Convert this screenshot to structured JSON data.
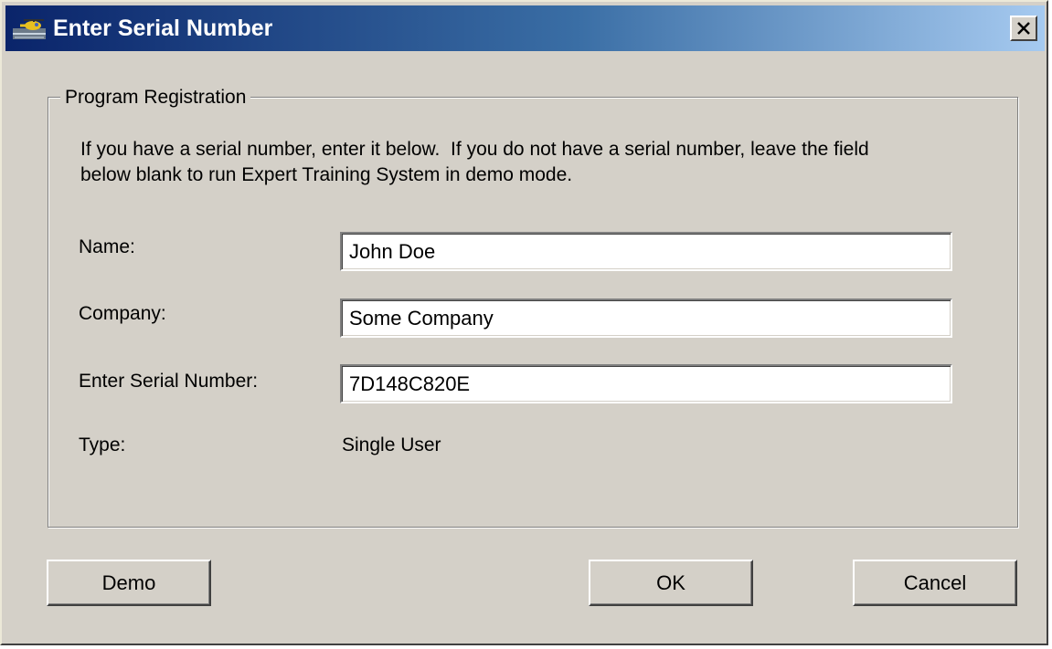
{
  "window": {
    "title": "Enter Serial Number",
    "app_icon": "helicopter-icon",
    "close_icon": "close-x-icon",
    "title_gradient": [
      "#0a246a",
      "#a6caf0"
    ],
    "face_color": "#d4d0c8"
  },
  "group": {
    "label": "Program Registration",
    "instructions_line1": "If you have a serial number, enter it below.  If you do not have a serial number, leave the field",
    "instructions_line2": "below blank to run Expert Training System in demo mode."
  },
  "fields": {
    "name_label": "Name:",
    "name_value": "John Doe",
    "company_label": "Company:",
    "company_value": "Some Company",
    "serial_label": "Enter Serial Number:",
    "serial_value": "7D148C820E",
    "type_label": "Type:",
    "type_value": "Single User"
  },
  "buttons": {
    "demo": "Demo",
    "ok": "OK",
    "cancel": "Cancel"
  }
}
